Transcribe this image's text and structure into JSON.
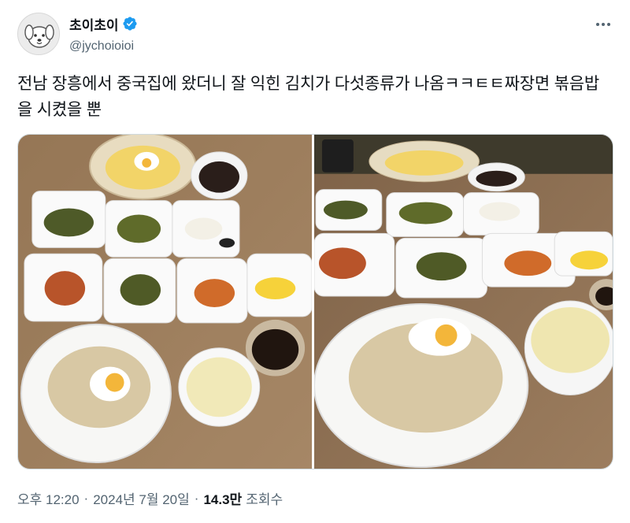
{
  "author": {
    "display_name": "초이초이",
    "handle": "@jychoioioi",
    "verified": true,
    "avatar_icon": "dog-avatar-icon",
    "verified_color": "#1d9bf0"
  },
  "tweet": {
    "text": "전남 장흥에서 중국집에 왔더니 잘 익힌 김치가 다섯종류가 나옴ㅋㅋㅌㅌ짜장면 볶음밥을 시켰을 뿐"
  },
  "meta": {
    "time": "오후 12:20",
    "date": "2024년 7월 20일",
    "views_count": "14.3만",
    "views_label": "조회수",
    "separator": "·"
  },
  "media": {
    "count": 2,
    "photos": [
      {
        "icon": "food-photo-icon"
      },
      {
        "icon": "food-photo-icon"
      }
    ]
  }
}
